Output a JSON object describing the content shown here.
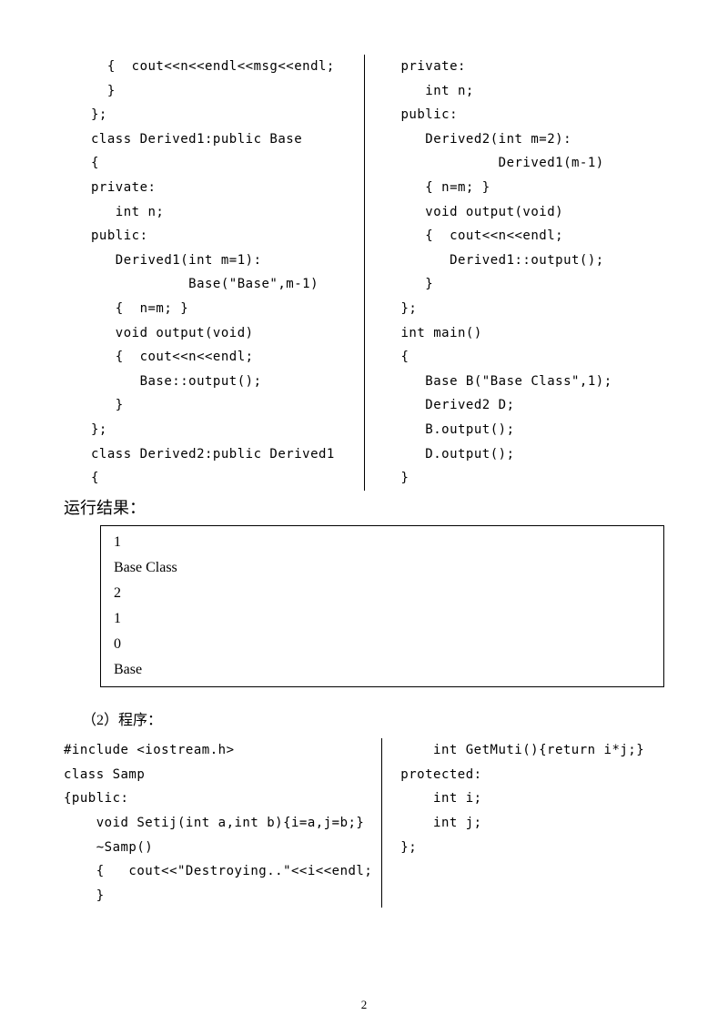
{
  "code1_left": "  {  cout<<n<<endl<<msg<<endl;\n  }\n};\nclass Derived1:public Base\n{\nprivate:\n   int n;\npublic:\n   Derived1(int m=1):\n            Base(\"Base\",m-1)\n   {  n=m; }\n   void output(void)\n   {  cout<<n<<endl;\n      Base::output();\n   }\n};\nclass Derived2:public Derived1\n{",
  "code1_right": "private:\n   int n;\npublic:\n   Derived2(int m=2):\n            Derived1(m-1)\n   { n=m; }\n   void output(void)\n   {  cout<<n<<endl;\n      Derived1::output();\n   }\n};\nint main()\n{\n   Base B(\"Base Class\",1);\n   Derived2 D;\n   B.output();\n   D.output();\n}",
  "heading_result": "运行结果：",
  "result_lines": [
    "1",
    "Base Class",
    "2",
    "1",
    "0",
    "Base"
  ],
  "heading2": "（2）程序：",
  "code2_left": "#include <iostream.h>\nclass Samp\n{public:\n    void Setij(int a,int b){i=a,j=b;}\n    ~Samp()\n    {   cout<<\"Destroying..\"<<i<<endl;\n    }",
  "code2_right": "    int GetMuti(){return i*j;}\nprotected:\n    int i;\n    int j;\n};",
  "page_number": "2"
}
